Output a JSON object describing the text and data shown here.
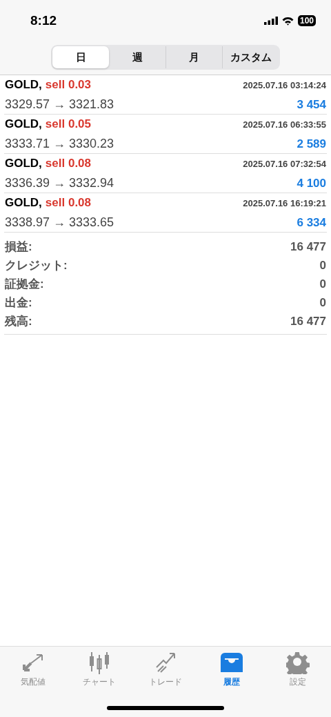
{
  "status_bar": {
    "time": "8:12",
    "battery": "100"
  },
  "period_tabs": [
    {
      "label": "日",
      "selected": true
    },
    {
      "label": "週",
      "selected": false
    },
    {
      "label": "月",
      "selected": false
    },
    {
      "label": "カスタム",
      "selected": false
    }
  ],
  "trades": [
    {
      "symbol": "GOLD,",
      "order": "sell 0.03",
      "time": "2025.07.16 03:14:24",
      "prices": "3329.57 → 3321.83",
      "profit": "3 454"
    },
    {
      "symbol": "GOLD,",
      "order": "sell 0.05",
      "time": "2025.07.16 06:33:55",
      "prices": "3333.71 → 3330.23",
      "profit": "2 589"
    },
    {
      "symbol": "GOLD,",
      "order": "sell 0.08",
      "time": "2025.07.16 07:32:54",
      "prices": "3336.39 → 3332.94",
      "profit": "4 100"
    },
    {
      "symbol": "GOLD,",
      "order": "sell 0.08",
      "time": "2025.07.16 16:19:21",
      "prices": "3338.97 → 3333.65",
      "profit": "6 334"
    }
  ],
  "summary": [
    {
      "label": "損益:",
      "value": "16 477"
    },
    {
      "label": "クレジット:",
      "value": "0"
    },
    {
      "label": "証拠金:",
      "value": "0"
    },
    {
      "label": "出金:",
      "value": "0"
    },
    {
      "label": "残高:",
      "value": "16 477"
    }
  ],
  "bottom_tabs": [
    {
      "label": "気配値",
      "selected": false
    },
    {
      "label": "チャート",
      "selected": false
    },
    {
      "label": "トレード",
      "selected": false
    },
    {
      "label": "履歴",
      "selected": true
    },
    {
      "label": "設定",
      "selected": false
    }
  ]
}
